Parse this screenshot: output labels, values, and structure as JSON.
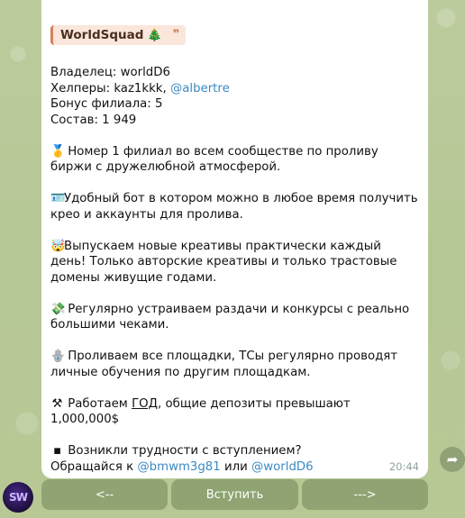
{
  "header_tag": {
    "title": "WorldSquad",
    "emoji": "🎄",
    "quote": "❞"
  },
  "info": {
    "owner_label": "Владелец:",
    "owner": "worldD6",
    "helpers_label": "Хелперы:",
    "helper1": "kaz1kkk,",
    "helper2": "@albertre",
    "bonus": "Бонус филиала: 5",
    "members": "Состав: 1 949"
  },
  "points": [
    {
      "icon": "🥇",
      "text": "Номер 1 филиал во всем сообществе по проливу биржи с дружелюбной атмосферой."
    },
    {
      "icon": "🪪",
      "text": "Удобный бот в котором можно в любое время получить крео и аккаунты для пролива."
    },
    {
      "icon": "🤯",
      "text": "Выпускаем новые креативы практически каждый день! Только авторские креативы и только трастовые домены живущие годами."
    },
    {
      "icon": "💸",
      "text": "Регулярно устраиваем раздачи и конкурсы с реально большими чеками."
    },
    {
      "icon": "🪬",
      "text": "Проливаем все площадки, ТСы регулярно проводят личные обучения по другим площадкам."
    }
  ],
  "deposit": {
    "icon": "⚒",
    "before": "Работаем",
    "link": "ГОД",
    "after": ", общие депозиты превышают 1,000,000$"
  },
  "contact": {
    "icon": "▪",
    "question": "Возникли трудности с вступлением?",
    "prefix": "Обращайся к",
    "user1": "@bmwm3g81",
    "or": "или",
    "user2": "@worldD6"
  },
  "time": "20:44",
  "avatar_text": "SW",
  "keyboard": {
    "prev": "<--",
    "join": "Вступить",
    "next": "--->"
  }
}
